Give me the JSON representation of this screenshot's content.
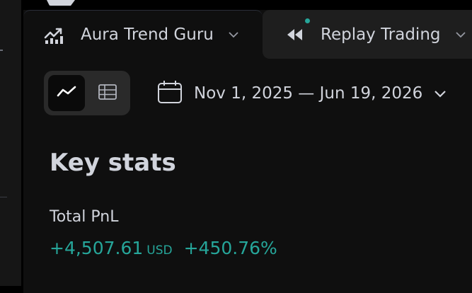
{
  "tabs": [
    {
      "label": "Aura Trend Guru",
      "icon": "trend-chart-icon",
      "active": true
    },
    {
      "label": "Replay Trading",
      "icon": "rewind-icon",
      "active": false
    }
  ],
  "view_toggle": {
    "options": [
      "line-chart-view",
      "table-view"
    ],
    "selected": "line-chart-view"
  },
  "date_range": {
    "label": "Nov 1, 2025 — Jun 19, 2026"
  },
  "key_stats": {
    "title": "Key stats",
    "total_pnl": {
      "label": "Total PnL",
      "amount": "+4,507.61",
      "currency": "USD",
      "percent": "+450.76%"
    }
  },
  "colors": {
    "background": "#0f0f0f",
    "text": "#d1d4dc",
    "positive": "#26a69a",
    "status_dot": "#26a69a"
  }
}
